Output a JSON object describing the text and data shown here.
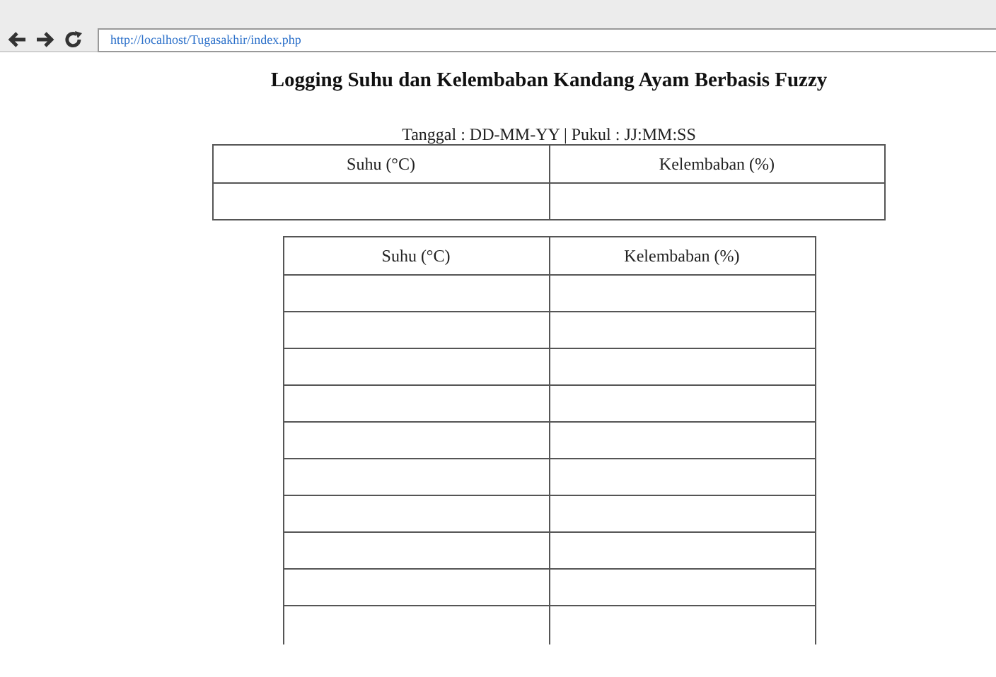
{
  "browser": {
    "url": "http://localhost/Tugasakhir/index.php"
  },
  "title": "Logging Suhu dan Kelembaban Kandang Ayam Berbasis Fuzzy",
  "timestamp": "Tanggal : DD-MM-YY | Pukul : JJ:MM:SS",
  "current_table": {
    "columns": [
      "Suhu (°C)",
      "Kelembaban (%)"
    ],
    "rows": [
      {
        "kind": "empty"
      }
    ]
  },
  "log_table": {
    "columns": [
      "Suhu (°C)",
      "Kelembaban (%)"
    ],
    "rows": [
      {
        "kind": "empty"
      },
      {
        "kind": "empty"
      },
      {
        "kind": "empty"
      },
      {
        "kind": "empty"
      },
      {
        "kind": "empty"
      },
      {
        "kind": "empty"
      },
      {
        "kind": "empty"
      },
      {
        "kind": "empty"
      },
      {
        "kind": "empty"
      },
      {
        "kind": "empty"
      }
    ]
  }
}
